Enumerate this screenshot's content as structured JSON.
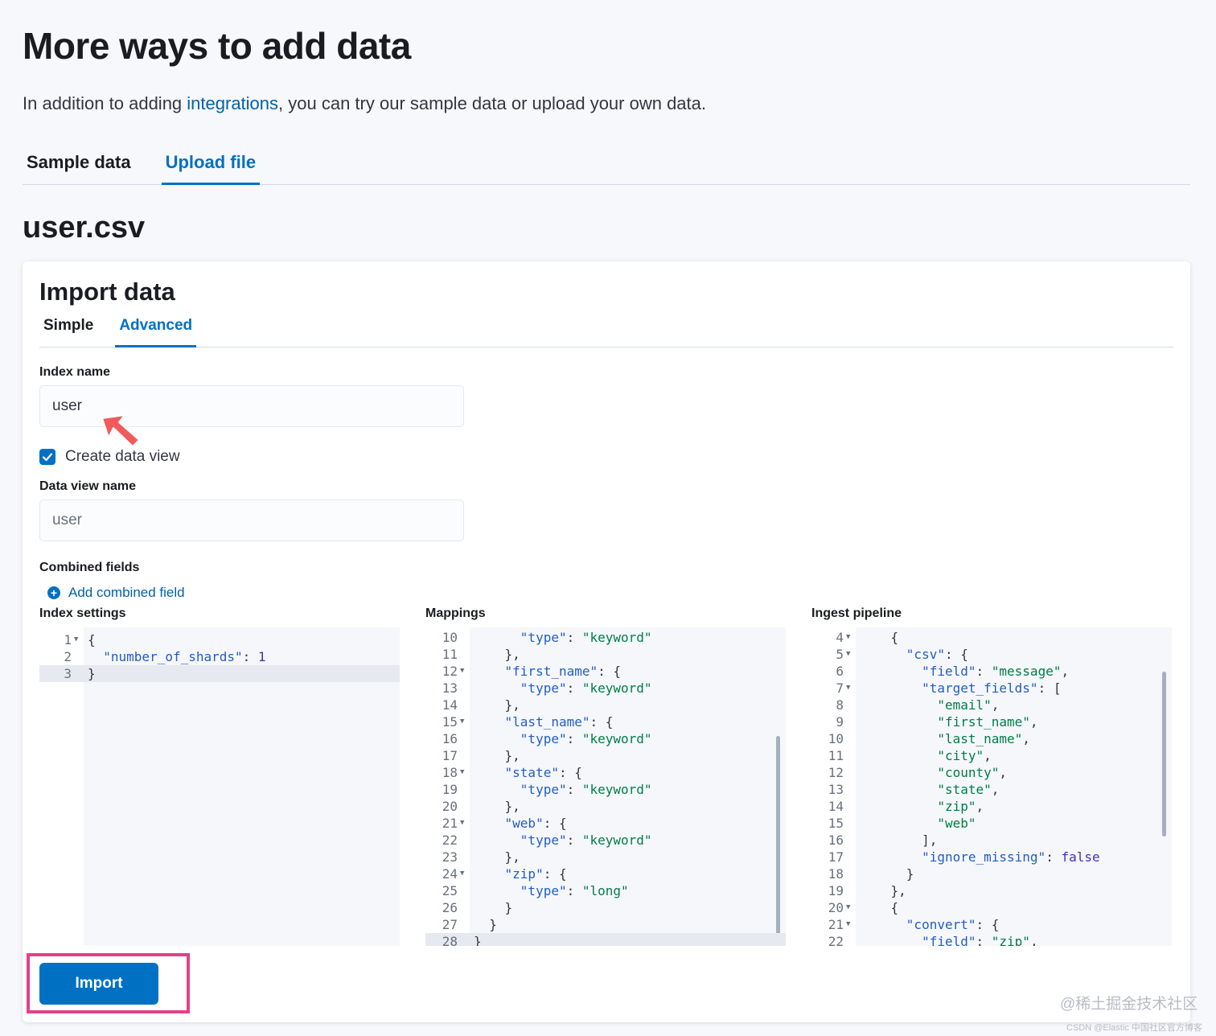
{
  "page": {
    "title": "More ways to add data",
    "intro_before": "In addition to adding ",
    "intro_link": "integrations",
    "intro_after": ", you can try our sample data or upload your own data.",
    "tabs": [
      {
        "label": "Sample data",
        "active": false
      },
      {
        "label": "Upload file",
        "active": true
      }
    ],
    "file_name": "user.csv"
  },
  "import": {
    "title": "Import data",
    "tabs": [
      {
        "label": "Simple",
        "active": false
      },
      {
        "label": "Advanced",
        "active": true
      }
    ],
    "index_name_label": "Index name",
    "index_name_value": "user",
    "create_data_view_label": "Create data view",
    "create_data_view_checked": true,
    "data_view_name_label": "Data view name",
    "data_view_name_placeholder": "user",
    "combined_fields_label": "Combined fields",
    "add_combined_field_label": "Add combined field",
    "import_button_label": "Import"
  },
  "editors": {
    "index_settings": {
      "label": "Index settings",
      "active_line": 3,
      "lines": [
        {
          "n": "1",
          "fold": true,
          "code": "{"
        },
        {
          "n": "2",
          "fold": false,
          "code": "  \"number_of_shards\": 1"
        },
        {
          "n": "3",
          "fold": false,
          "code": "}"
        }
      ]
    },
    "mappings": {
      "label": "Mappings",
      "active_line": 28,
      "lines": [
        {
          "n": "10",
          "fold": false,
          "code": "      \"type\": \"keyword\""
        },
        {
          "n": "11",
          "fold": false,
          "code": "    },"
        },
        {
          "n": "12",
          "fold": true,
          "code": "    \"first_name\": {"
        },
        {
          "n": "13",
          "fold": false,
          "code": "      \"type\": \"keyword\""
        },
        {
          "n": "14",
          "fold": false,
          "code": "    },"
        },
        {
          "n": "15",
          "fold": true,
          "code": "    \"last_name\": {"
        },
        {
          "n": "16",
          "fold": false,
          "code": "      \"type\": \"keyword\""
        },
        {
          "n": "17",
          "fold": false,
          "code": "    },"
        },
        {
          "n": "18",
          "fold": true,
          "code": "    \"state\": {"
        },
        {
          "n": "19",
          "fold": false,
          "code": "      \"type\": \"keyword\""
        },
        {
          "n": "20",
          "fold": false,
          "code": "    },"
        },
        {
          "n": "21",
          "fold": true,
          "code": "    \"web\": {"
        },
        {
          "n": "22",
          "fold": false,
          "code": "      \"type\": \"keyword\""
        },
        {
          "n": "23",
          "fold": false,
          "code": "    },"
        },
        {
          "n": "24",
          "fold": true,
          "code": "    \"zip\": {"
        },
        {
          "n": "25",
          "fold": false,
          "code": "      \"type\": \"long\""
        },
        {
          "n": "26",
          "fold": false,
          "code": "    }"
        },
        {
          "n": "27",
          "fold": false,
          "code": "  }"
        },
        {
          "n": "28",
          "fold": false,
          "code": "}"
        }
      ]
    },
    "ingest_pipeline": {
      "label": "Ingest pipeline",
      "active_line": 0,
      "lines": [
        {
          "n": "4",
          "fold": true,
          "code": "    {"
        },
        {
          "n": "5",
          "fold": true,
          "code": "      \"csv\": {"
        },
        {
          "n": "6",
          "fold": false,
          "code": "        \"field\": \"message\","
        },
        {
          "n": "7",
          "fold": true,
          "code": "        \"target_fields\": ["
        },
        {
          "n": "8",
          "fold": false,
          "code": "          \"email\","
        },
        {
          "n": "9",
          "fold": false,
          "code": "          \"first_name\","
        },
        {
          "n": "10",
          "fold": false,
          "code": "          \"last_name\","
        },
        {
          "n": "11",
          "fold": false,
          "code": "          \"city\","
        },
        {
          "n": "12",
          "fold": false,
          "code": "          \"county\","
        },
        {
          "n": "13",
          "fold": false,
          "code": "          \"state\","
        },
        {
          "n": "14",
          "fold": false,
          "code": "          \"zip\","
        },
        {
          "n": "15",
          "fold": false,
          "code": "          \"web\""
        },
        {
          "n": "16",
          "fold": false,
          "code": "        ],"
        },
        {
          "n": "17",
          "fold": false,
          "code": "        \"ignore_missing\": false"
        },
        {
          "n": "18",
          "fold": false,
          "code": "      }"
        },
        {
          "n": "19",
          "fold": false,
          "code": "    },"
        },
        {
          "n": "20",
          "fold": true,
          "code": "    {"
        },
        {
          "n": "21",
          "fold": true,
          "code": "      \"convert\": {"
        },
        {
          "n": "22",
          "fold": false,
          "code": "        \"field\": \"zip\","
        }
      ]
    }
  },
  "watermark": {
    "main": "@稀土掘金技术社区",
    "sub": "CSDN @Elastic 中国社区官方博客"
  },
  "colors": {
    "accent": "#0071c2",
    "link": "#0061a6",
    "highlight": "#e0428a",
    "arrow": "#f05a5a"
  },
  "icons": {
    "checkbox": "check-icon",
    "add": "plus-circle-icon",
    "annotation": "arrow-icon"
  }
}
